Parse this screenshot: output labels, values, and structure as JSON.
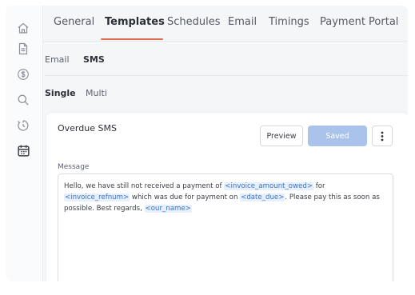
{
  "sidebar": {
    "icons": [
      "home-icon",
      "document-icon",
      "dollar-icon",
      "search-icon",
      "reminder-icon",
      "calendar-icon"
    ]
  },
  "tabs": [
    {
      "label": "General"
    },
    {
      "label": "Templates",
      "active": true
    },
    {
      "label": "Schedules"
    },
    {
      "label": "Email"
    },
    {
      "label": "Timings"
    },
    {
      "label": "Payment Portal"
    }
  ],
  "channel_tabs": [
    {
      "label": "Email"
    },
    {
      "label": "SMS",
      "active": true
    }
  ],
  "mode_tabs": [
    {
      "label": "Single",
      "active": true
    },
    {
      "label": "Multi"
    }
  ],
  "template": {
    "title": "Overdue SMS",
    "preview_label": "Preview",
    "saved_label": "Saved",
    "message_label": "Message",
    "message": {
      "t1": "Hello, we have still not received a payment of ",
      "v1": "<invoice_amount_owed>",
      "t2": " for ",
      "v2": "<invoice_refnum>",
      "t3": " which was due for payment on ",
      "v3": "<date_due>",
      "t4": ". Please pay this as soon as possible. Best regards, ",
      "v4": "<our_name>"
    }
  },
  "colors": {
    "accent": "#e06d4f",
    "primary_button_disabled": "#a9c3ea",
    "variable_text": "#3d74c9",
    "variable_bg": "#e6effc"
  }
}
